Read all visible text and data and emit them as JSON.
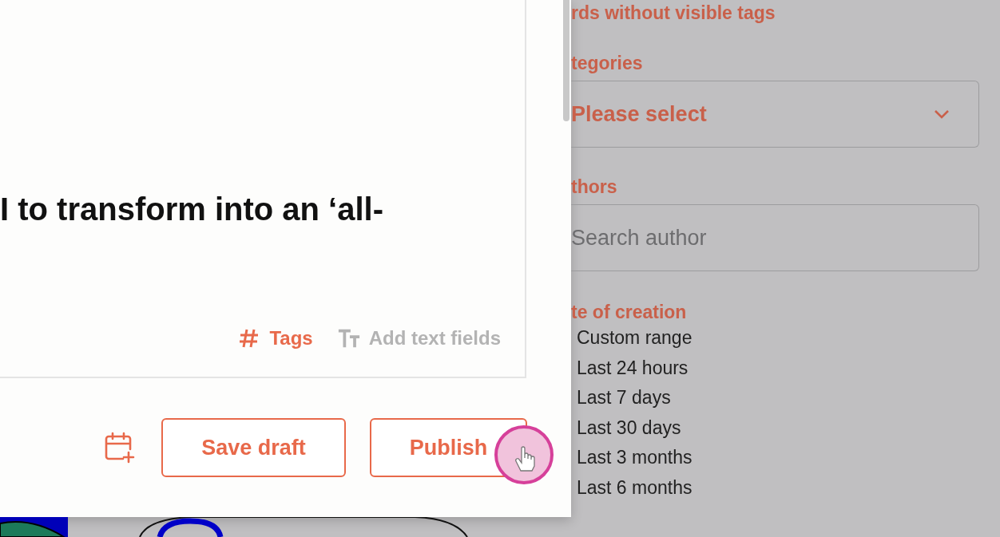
{
  "editor": {
    "headline": "I to transform into an ‘all-",
    "toolbar": [
      {
        "kind": "tags",
        "label": "Tags",
        "disabled": false
      },
      {
        "kind": "text_fields",
        "label": "Add text fields",
        "disabled": true
      }
    ]
  },
  "footer": {
    "buttons": [
      "Save draft",
      "Publish"
    ]
  },
  "filters": {
    "tags_option": "rds without visible tags",
    "categories": {
      "label": "tegories",
      "placeholder": "Please select"
    },
    "authors": {
      "label": "thors",
      "placeholder": "Search author"
    },
    "date": {
      "label": "te of creation",
      "options": [
        "Custom range",
        "Last 24 hours",
        "Last 7 days",
        "Last 30 days",
        "Last 3 months",
        "Last 6 months"
      ]
    }
  }
}
